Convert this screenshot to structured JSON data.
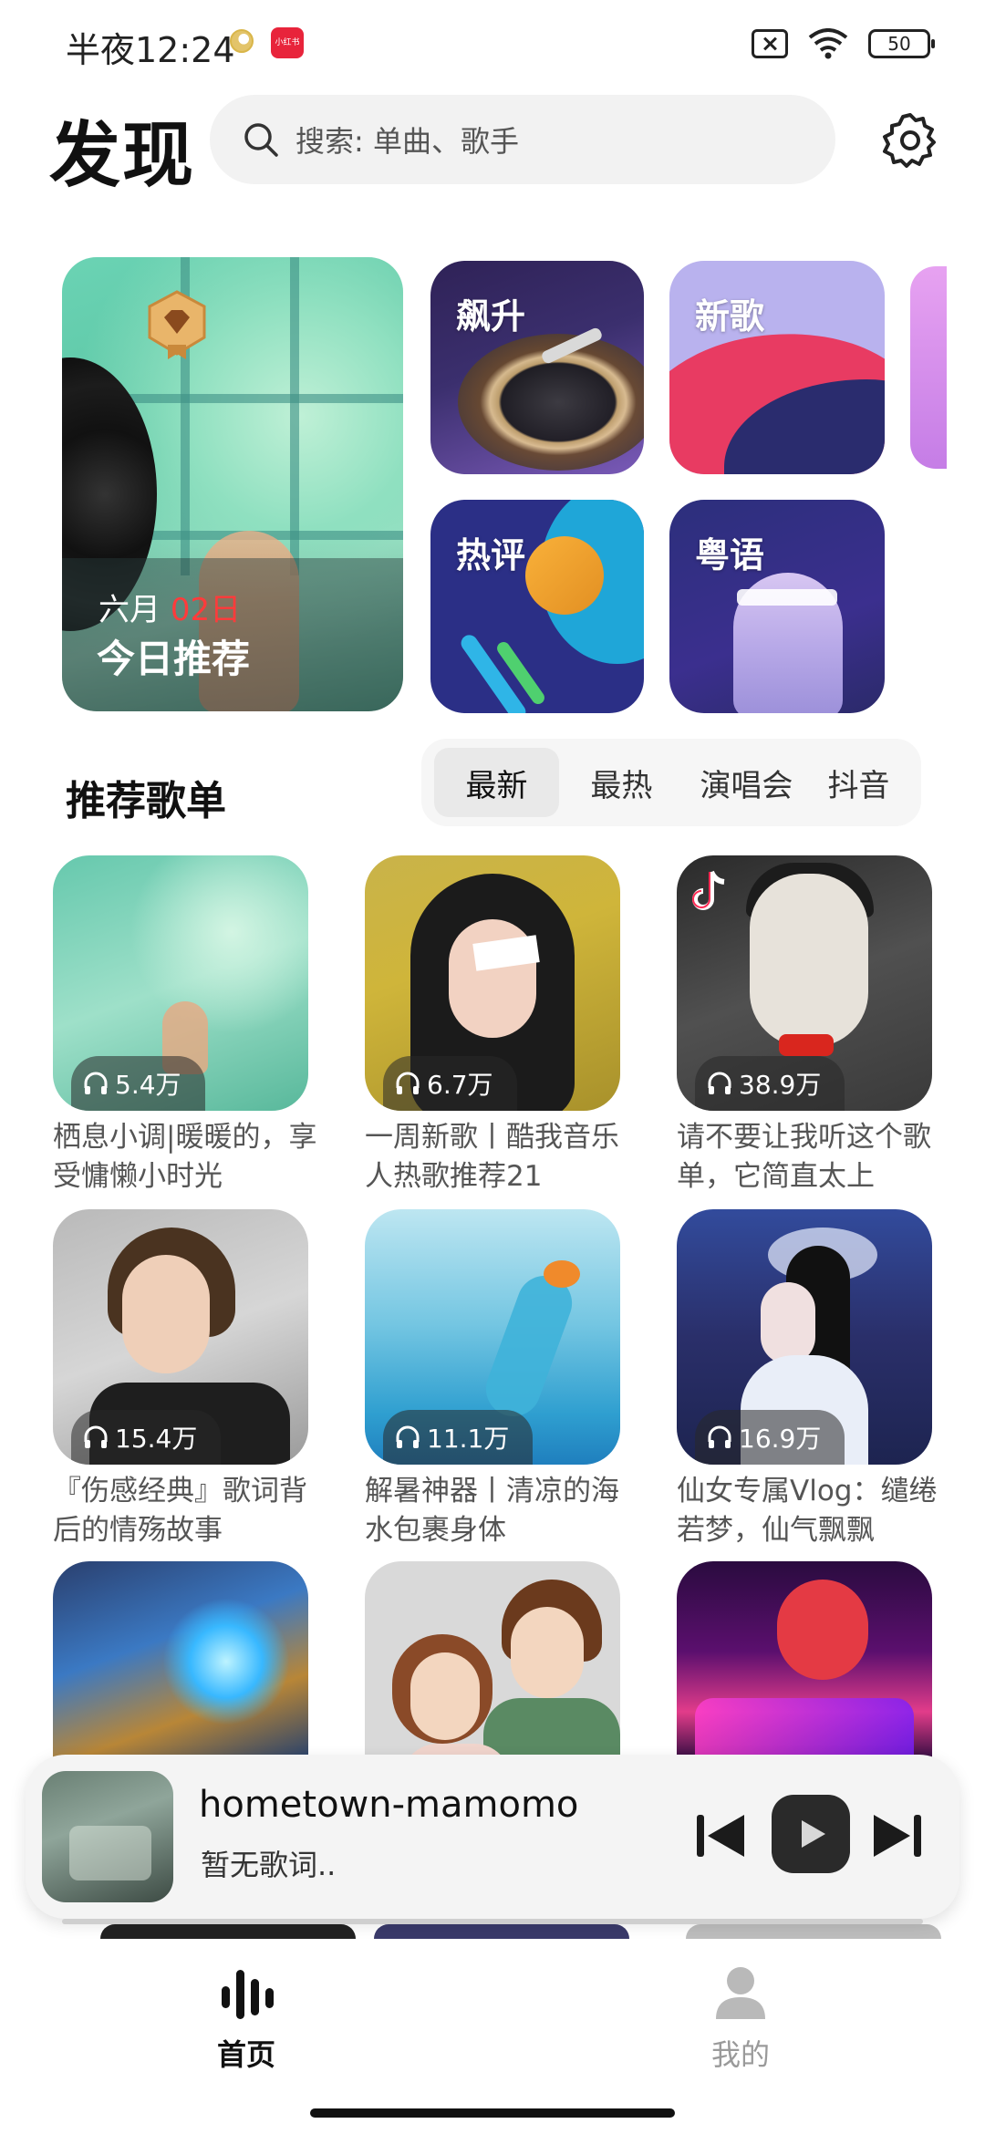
{
  "status_bar": {
    "time": "半夜12:24",
    "app_badge": "小红书",
    "battery": "50"
  },
  "header": {
    "title": "发现",
    "search_placeholder": "搜索: 单曲、歌手"
  },
  "feature_cards": {
    "daily": {
      "month": "六月",
      "day": "02日",
      "title": "今日推荐"
    },
    "rise": "飙升",
    "new_songs": "新歌",
    "hot_comments": "热评",
    "cantonese": "粤语"
  },
  "section": {
    "title": "推荐歌单",
    "tabs": [
      "最新",
      "最热",
      "演唱会",
      "抖音"
    ],
    "active_tab": "最新"
  },
  "playlists": [
    {
      "plays": "5.4万",
      "name": "栖息小调|暖暖的，享受慵懒小时光"
    },
    {
      "plays": "6.7万",
      "name": "一周新歌丨酷我音乐人热歌推荐21"
    },
    {
      "plays": "38.9万",
      "name": "请不要让我听这个歌单，它简直太上"
    },
    {
      "plays": "15.4万",
      "name": "『伤感经典』歌词背后的情殇故事"
    },
    {
      "plays": "11.1万",
      "name": "解暑神器丨清凉的海水包裹身体"
    },
    {
      "plays": "16.9万",
      "name": "仙女专属Vlog：缱绻若梦，仙气飘飘"
    }
  ],
  "player": {
    "title": "hometown-mamomo",
    "lyric": "暂无歌词.."
  },
  "nav": {
    "home": "首页",
    "me": "我的"
  }
}
